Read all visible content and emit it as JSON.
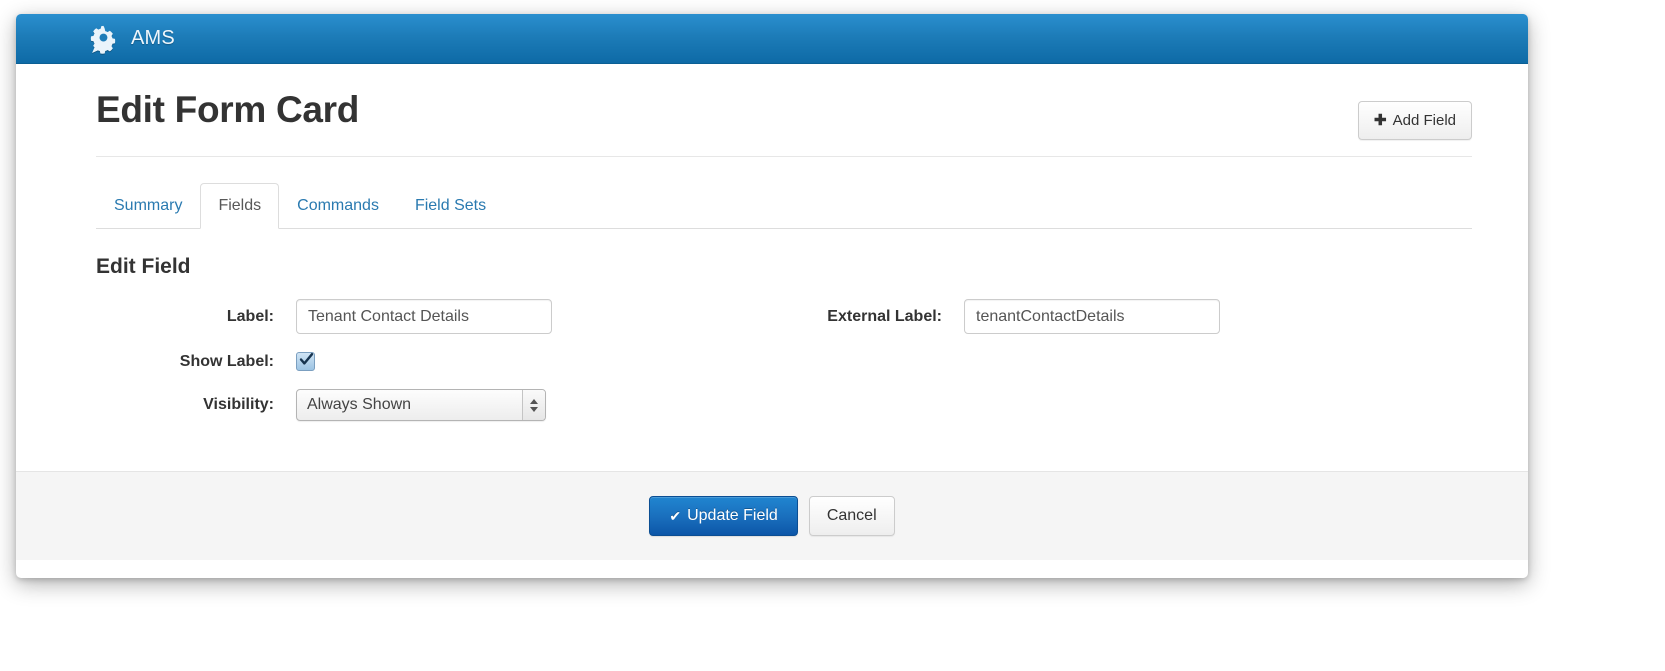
{
  "navbar": {
    "brand_label": "AMS",
    "brand_icon": "gear-speech-bubble-icon",
    "background_color": "#1d7cb8"
  },
  "header": {
    "title": "Edit Form Card",
    "add_field_button": {
      "label": "Add Field",
      "icon": "plus-icon"
    }
  },
  "tabs": [
    {
      "label": "Summary",
      "active": false
    },
    {
      "label": "Fields",
      "active": true
    },
    {
      "label": "Commands",
      "active": false
    },
    {
      "label": "Field Sets",
      "active": false
    }
  ],
  "form": {
    "section_title": "Edit Field",
    "label_field": {
      "label": "Label:",
      "value": "Tenant Contact Details",
      "placeholder": ""
    },
    "external_label_field": {
      "label": "External Label:",
      "value": "tenantContactDetails",
      "placeholder": ""
    },
    "show_label_field": {
      "label": "Show Label:",
      "checked": true
    },
    "visibility_field": {
      "label": "Visibility:",
      "selected": "Always Shown",
      "options": [
        "Always Shown"
      ]
    }
  },
  "footer": {
    "update_button": {
      "label": "Update Field",
      "icon": "check-icon"
    },
    "cancel_button": {
      "label": "Cancel"
    }
  },
  "colors": {
    "navbar": "#1d7cb8",
    "primary_button": "#1a6fbd",
    "tab_link": "#2a7ab0"
  }
}
